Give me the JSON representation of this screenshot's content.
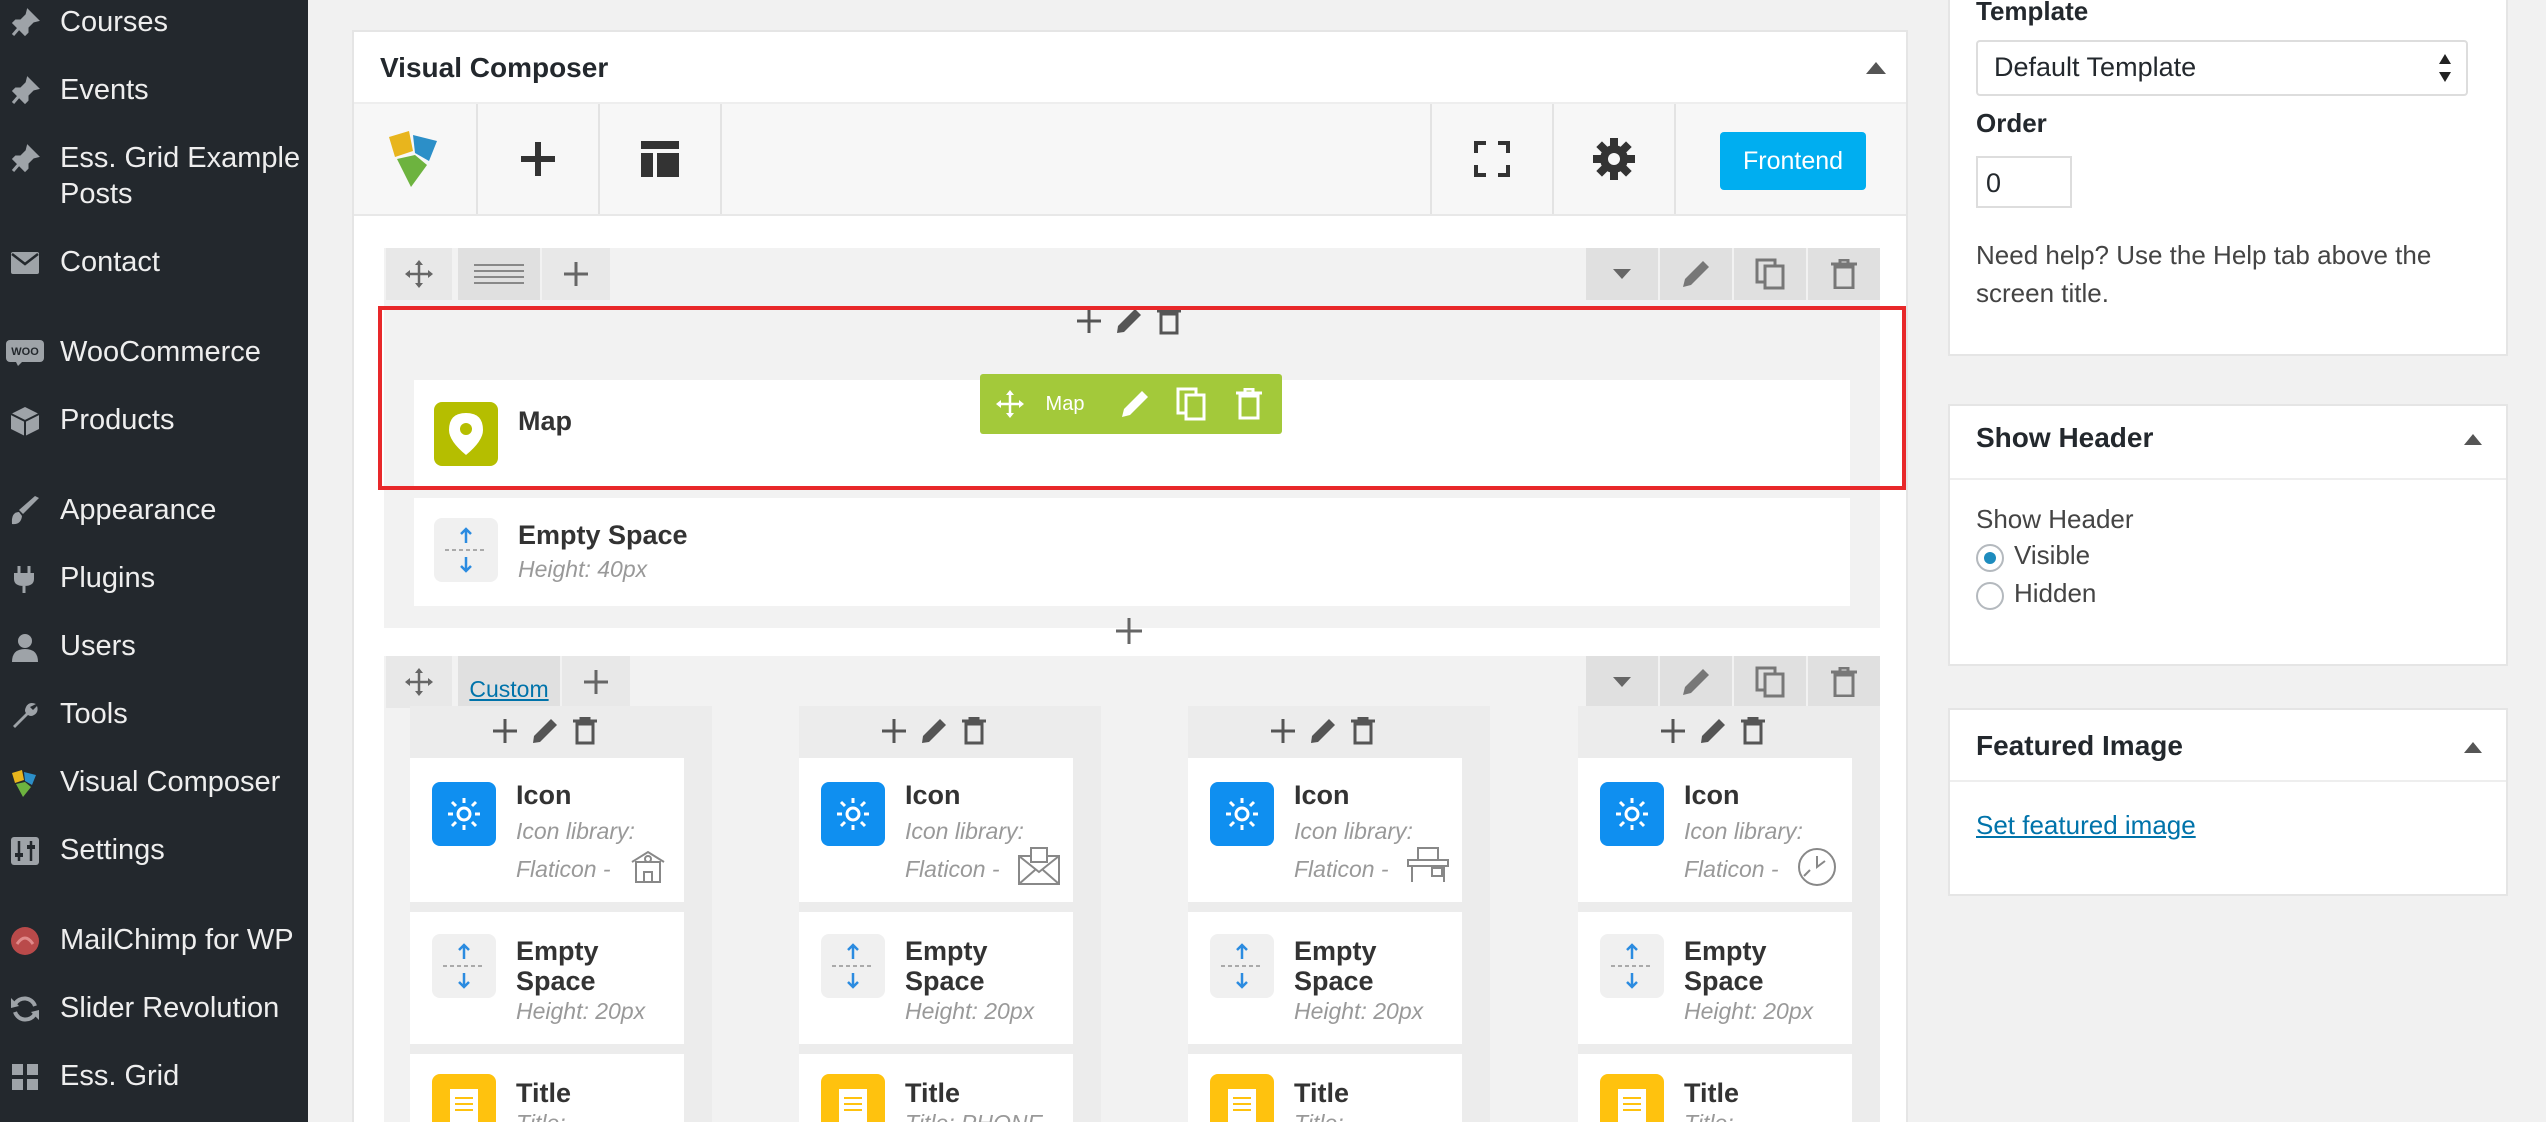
{
  "sidebar": {
    "items": [
      {
        "label": "Courses",
        "icon": "pin-icon"
      },
      {
        "label": "Events",
        "icon": "pin-icon"
      },
      {
        "label": "Ess. Grid Example Posts",
        "icon": "pin-icon"
      },
      {
        "label": "Contact",
        "icon": "envelope-icon"
      },
      {
        "label": "WooCommerce",
        "icon": "woocommerce-icon"
      },
      {
        "label": "Products",
        "icon": "box-icon"
      },
      {
        "label": "Appearance",
        "icon": "brush-icon"
      },
      {
        "label": "Plugins",
        "icon": "plug-icon"
      },
      {
        "label": "Users",
        "icon": "user-icon"
      },
      {
        "label": "Tools",
        "icon": "wrench-icon"
      },
      {
        "label": "Visual Composer",
        "icon": "vc-logo-icon"
      },
      {
        "label": "Settings",
        "icon": "sliders-icon"
      },
      {
        "label": "MailChimp for WP",
        "icon": "mailchimp-icon"
      },
      {
        "label": "Slider Revolution",
        "icon": "refresh-icon"
      },
      {
        "label": "Ess. Grid",
        "icon": "grid-icon"
      }
    ]
  },
  "composer": {
    "title": "Visual Composer",
    "frontend_label": "Frontend",
    "row1": {
      "map": {
        "title": "Map",
        "hover_label": "Map"
      },
      "empty_space": {
        "title": "Empty Space",
        "sub": "Height: 40px"
      }
    },
    "row2": {
      "tab_label": "Custom",
      "columns": [
        {
          "icon_title": "Icon",
          "icon_sub1": "Icon library:",
          "icon_sub2": "Flaticon -",
          "glyph": "school-icon",
          "space_title1": "Empty",
          "space_title2": "Space",
          "space_sub": "Height: 20px",
          "title_title": "Title",
          "title_sub": "Title:"
        },
        {
          "icon_title": "Icon",
          "icon_sub1": "Icon library:",
          "icon_sub2": "Flaticon -",
          "glyph": "envelope-icon",
          "space_title1": "Empty",
          "space_title2": "Space",
          "space_sub": "Height: 20px",
          "title_title": "Title",
          "title_sub": "Title: PHONE"
        },
        {
          "icon_title": "Icon",
          "icon_sub1": "Icon library:",
          "icon_sub2": "Flaticon -",
          "glyph": "desk-icon",
          "space_title1": "Empty",
          "space_title2": "Space",
          "space_sub": "Height: 20px",
          "title_title": "Title",
          "title_sub": "Title:"
        },
        {
          "icon_title": "Icon",
          "icon_sub1": "Icon library:",
          "icon_sub2": "Flaticon -",
          "glyph": "clock-icon",
          "space_title1": "Empty",
          "space_title2": "Space",
          "space_sub": "Height: 20px",
          "title_title": "Title",
          "title_sub": "Title:"
        }
      ]
    }
  },
  "page_attributes": {
    "template_label": "Template",
    "template_value": "Default Template",
    "order_label": "Order",
    "order_value": "0",
    "help_line1": "Need help? Use the Help tab above the",
    "help_line2": "screen title."
  },
  "show_header": {
    "title": "Show Header",
    "field_label": "Show Header",
    "options": [
      {
        "label": "Visible",
        "checked": true
      },
      {
        "label": "Hidden",
        "checked": false
      }
    ]
  },
  "featured_image": {
    "title": "Featured Image",
    "link": "Set featured image"
  },
  "colors": {
    "accent_blue": "#00aef0",
    "map_green": "#a3c93a",
    "highlight_red": "#e8282a",
    "icon_blue": "#0f8ff0",
    "title_yellow": "#ffc20e"
  }
}
